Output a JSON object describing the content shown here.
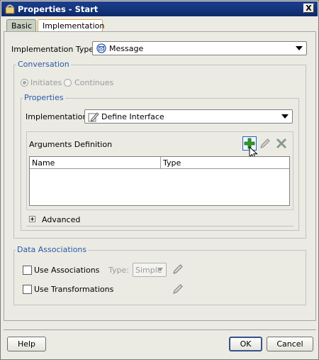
{
  "window": {
    "title": "Properties - Start",
    "close_label": "X"
  },
  "tabs": [
    {
      "label": "Basic"
    },
    {
      "label": "Implementation"
    }
  ],
  "implementation_type": {
    "label": "Implementation Type:",
    "value": "Message"
  },
  "conversation": {
    "legend": "Conversation",
    "options": [
      {
        "label": "Initiates",
        "selected": true
      },
      {
        "label": "Continues",
        "selected": false
      }
    ]
  },
  "properties": {
    "legend": "Properties",
    "implementation": {
      "label": "Implementation:",
      "value": "Define Interface"
    },
    "arguments": {
      "title": "Arguments Definition",
      "columns": [
        "Name",
        "Type"
      ]
    },
    "advanced": {
      "label": "Advanced",
      "expander": "+"
    }
  },
  "data_associations": {
    "legend": "Data Associations",
    "use_associations": "Use Associations",
    "type_label": "Type:",
    "type_value": "Simple",
    "use_transformations": "Use Transformations"
  },
  "buttons": {
    "help": "Help",
    "ok": "OK",
    "cancel": "Cancel"
  },
  "colors": {
    "title_bar": "#0e2a6a",
    "legend_blue": "#2a58a8",
    "add_icon_green": "#2e9a2e",
    "tab_active_border": "#e4a040"
  }
}
